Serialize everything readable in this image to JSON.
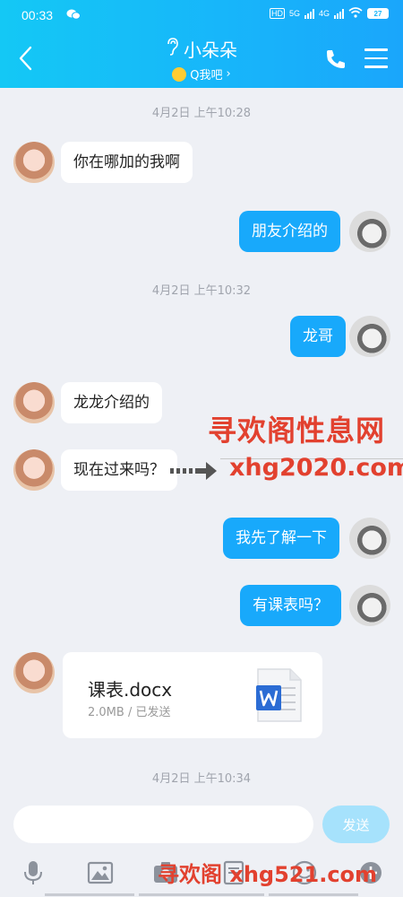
{
  "status_bar": {
    "time": "00:33",
    "network_labels": [
      "HD",
      "5G",
      "4G"
    ],
    "battery": "27"
  },
  "header": {
    "contact_name": "小朵朵",
    "subtitle": "Q我吧",
    "subtitle_chevron": "›",
    "accent_color": "#17b6fa"
  },
  "messages": [
    {
      "kind": "timestamp",
      "text": "4月2日 上午10:28"
    },
    {
      "kind": "in",
      "text": "你在哪加的我啊"
    },
    {
      "kind": "out",
      "text": "朋友介绍的"
    },
    {
      "kind": "timestamp",
      "text": "4月2日 上午10:32"
    },
    {
      "kind": "out",
      "text": "龙哥"
    },
    {
      "kind": "in",
      "text": "龙龙介绍的"
    },
    {
      "kind": "in",
      "text": "现在过来吗？"
    },
    {
      "kind": "out",
      "text": "我先了解一下"
    },
    {
      "kind": "out",
      "text": "有课表吗？"
    },
    {
      "kind": "file",
      "name": "课表.docx",
      "meta": "2.0MB / 已发送"
    },
    {
      "kind": "timestamp",
      "text": "4月2日 上午10:34"
    }
  ],
  "watermarks": {
    "title": "寻欢阁性息网",
    "site": "xhg2020.com",
    "bottom": "寻欢阁 xhg521.com"
  },
  "input": {
    "value": "",
    "send_label": "发送"
  },
  "toolbar": {
    "icons": [
      "microphone-icon",
      "image-icon",
      "camera-icon",
      "file-icon",
      "emoji-icon",
      "plus-icon"
    ]
  }
}
